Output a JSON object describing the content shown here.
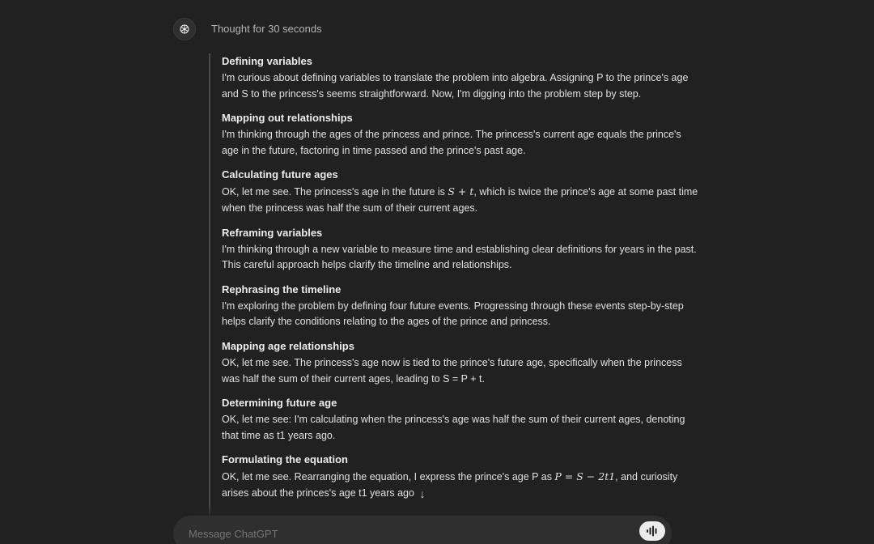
{
  "header": {
    "thought_label": "Thought for 30 seconds",
    "avatar_icon": "openai-logo-icon"
  },
  "steps": [
    {
      "title": "Defining variables",
      "body": "I'm curious about defining variables to translate the problem into algebra. Assigning P to the prince's age and S to the princess's seems straightforward. Now, I'm digging into the problem step by step."
    },
    {
      "title": "Mapping out relationships",
      "body": "I'm thinking through the ages of the princess and prince. The princess's current age equals the prince's age in the future, factoring in time passed and the prince's past age."
    },
    {
      "title": "Calculating future ages",
      "body_pre": "OK, let me see. The princess's age in the future is ",
      "body_math": "S + t",
      "body_post": ", which is twice the prince's age at some past time when the princess was half the sum of their current ages."
    },
    {
      "title": "Reframing variables",
      "body": "I'm thinking through a new variable to measure time and establishing clear definitions for years in the past. This careful approach helps clarify the timeline and relationships."
    },
    {
      "title": "Rephrasing the timeline",
      "body": "I'm exploring the problem by defining four future events. Progressing through these events step-by-step helps clarify the conditions relating to the ages of the prince and princess."
    },
    {
      "title": "Mapping age relationships",
      "body": "OK, let me see. The princess's age now is tied to the prince's future age, specifically when the princess was half the sum of their current ages, leading to S = P + t."
    },
    {
      "title": "Determining future age",
      "body": "OK, let me see: I'm calculating when the princess's age was half the sum of their current ages, denoting that time as t1 years ago."
    },
    {
      "title": "Formulating the equation",
      "body_pre": "OK, let me see. Rearranging the equation, I express the prince's age P as ",
      "body_math": "P = S − 2t1",
      "body_post": ", and curiosity arises about the princes's age t1 years ago."
    }
  ],
  "scroll_button": {
    "icon": "arrow-down-icon",
    "glyph": "↓"
  },
  "composer": {
    "placeholder": "Message ChatGPT",
    "voice_icon": "voice-waveform-icon"
  }
}
